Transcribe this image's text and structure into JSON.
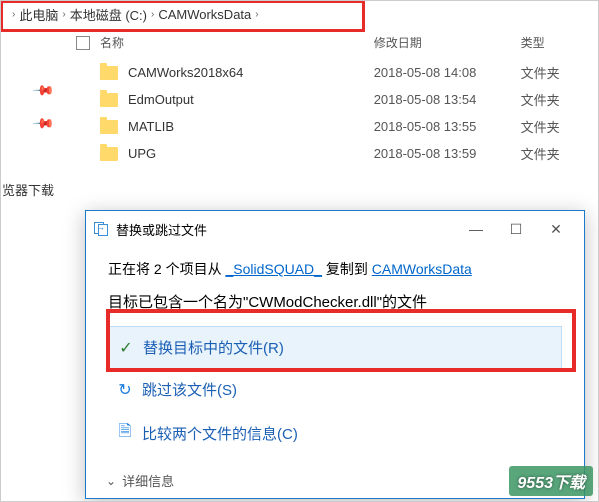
{
  "breadcrumb": {
    "items": [
      "此电脑",
      "本地磁盘 (C:)",
      "CAMWorksData"
    ]
  },
  "columns": {
    "name": "名称",
    "modified": "修改日期",
    "type": "类型"
  },
  "files": [
    {
      "name": "CAMWorks2018x64",
      "date": "2018-05-08 14:08",
      "type": "文件夹"
    },
    {
      "name": "EdmOutput",
      "date": "2018-05-08 13:54",
      "type": "文件夹"
    },
    {
      "name": "MATLIB",
      "date": "2018-05-08 13:55",
      "type": "文件夹"
    },
    {
      "name": "UPG",
      "date": "2018-05-08 13:59",
      "type": "文件夹"
    }
  ],
  "sidebar": {
    "label": "览器下载"
  },
  "dialog": {
    "title": "替换或跳过文件",
    "msg1_prefix": "正在将 2 个项目从 ",
    "msg1_link1": "_SolidSQUAD_",
    "msg1_mid": " 复制到 ",
    "msg1_link2": "CAMWorksData",
    "msg2": "目标已包含一个名为\"CWModChecker.dll\"的文件",
    "option_replace": "替换目标中的文件(R)",
    "option_skip": "跳过该文件(S)",
    "option_compare": "比较两个文件的信息(C)",
    "footer": "详细信息"
  },
  "watermark": "9553下载"
}
